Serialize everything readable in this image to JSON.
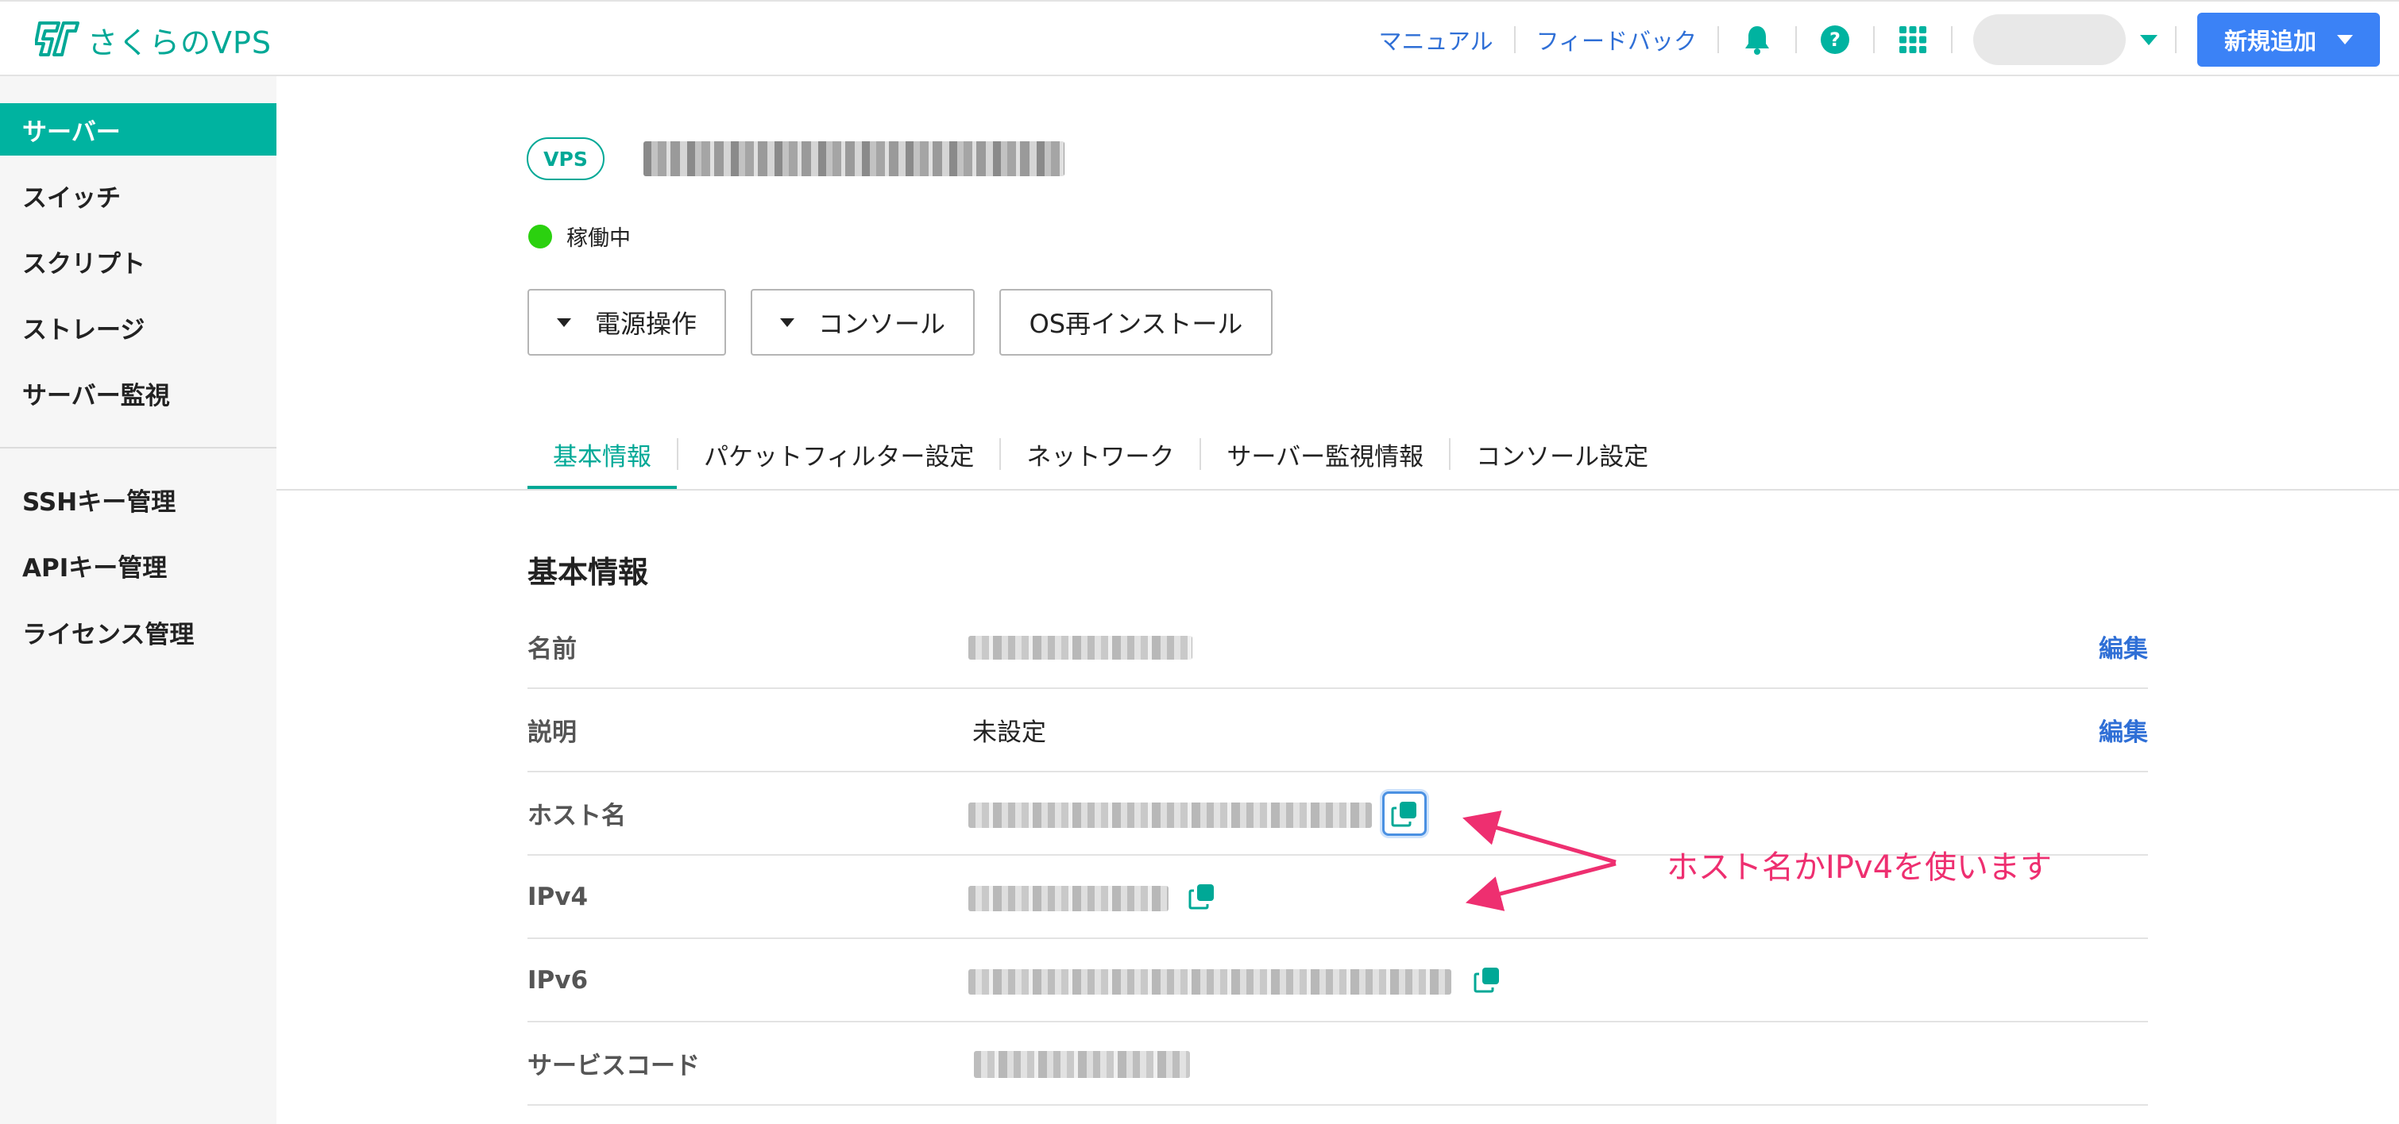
{
  "header": {
    "logo_text": "さくらのVPS",
    "links": [
      "マニュアル",
      "フィードバック"
    ],
    "new_button_label": "新規追加",
    "icons": [
      "bell-icon",
      "help-icon",
      "apps-grid-icon",
      "chevron-down-icon"
    ]
  },
  "sidebar": {
    "items": [
      {
        "label": "サーバー",
        "active": true
      },
      {
        "label": "スイッチ"
      },
      {
        "label": "スクリプト"
      },
      {
        "label": "ストレージ"
      },
      {
        "label": "サーバー監視"
      }
    ],
    "items2": [
      {
        "label": "SSHキー管理"
      },
      {
        "label": "APIキー管理"
      },
      {
        "label": "ライセンス管理"
      }
    ]
  },
  "server": {
    "badge": "VPS",
    "status": "稼働中",
    "status_color": "#2bd10f"
  },
  "actions": {
    "power": "電源操作",
    "console": "コンソール",
    "reinstall": "OS再インストール"
  },
  "tabs": [
    "基本情報",
    "パケットフィルター設定",
    "ネットワーク",
    "サーバー監視情報",
    "コンソール設定"
  ],
  "basic_info": {
    "title": "基本情報",
    "edit_label": "編集",
    "rows": [
      {
        "label": "名前"
      },
      {
        "label": "説明",
        "value": "未設定"
      },
      {
        "label": "ホスト名"
      },
      {
        "label": "IPv4"
      },
      {
        "label": "IPv6"
      },
      {
        "label": "サービスコード"
      }
    ]
  },
  "annotation": {
    "text": "ホスト名かIPv4を使います",
    "color": "#ee2f70"
  },
  "colors": {
    "accent": "#00b3a0",
    "link": "#2f6fd6",
    "primary_button": "#3b82f6"
  }
}
